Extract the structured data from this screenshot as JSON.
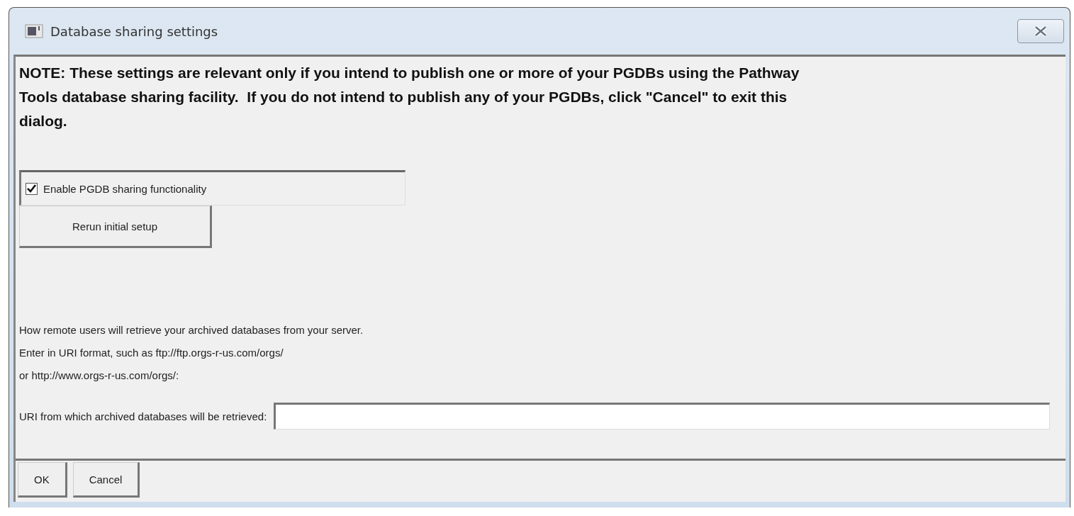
{
  "window": {
    "title": "Database sharing settings"
  },
  "note": "NOTE: These settings are relevant only if you intend to publish one or more of your PGDBs using the Pathway Tools database sharing facility.  If you do not intend to publish any of your PGDBs, click \"Cancel\" to exit this dialog.",
  "sharing_checkbox": {
    "label": "Enable PGDB sharing functionality",
    "checked": true
  },
  "rerun_button": "Rerun initial setup",
  "description": [
    "How remote users will retrieve your archived databases from your server.",
    "Enter in URI format, such as ftp://ftp.orgs-r-us.com/orgs/",
    "or http://www.orgs-r-us.com/orgs/:"
  ],
  "uri_field": {
    "label": "URI from which archived databases will be retrieved:"
  },
  "buttons": [
    "OK",
    "Cancel"
  ]
}
